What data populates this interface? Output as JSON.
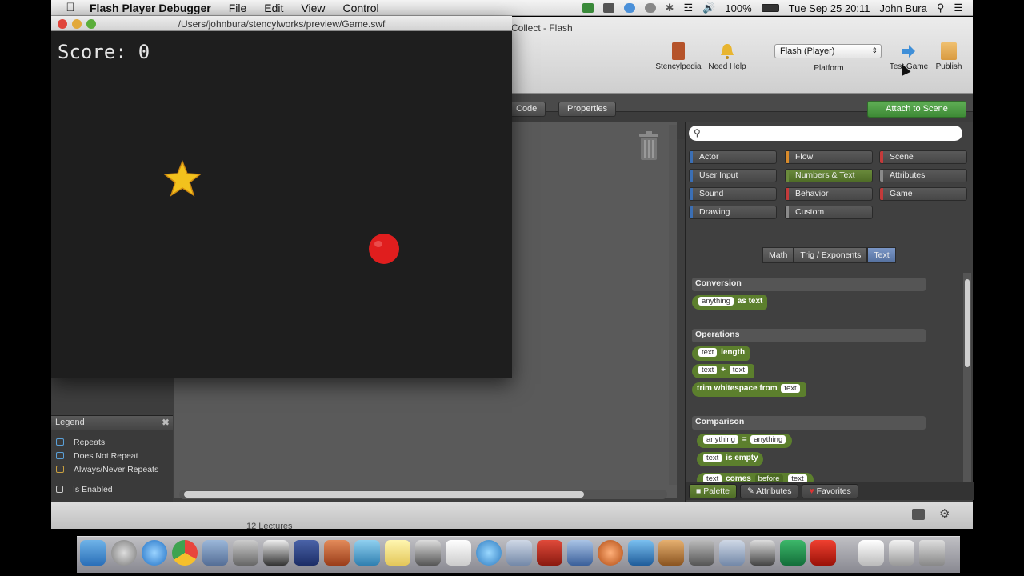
{
  "menubar": {
    "app_name": "Flash Player Debugger",
    "menus": [
      "File",
      "Edit",
      "View",
      "Control"
    ],
    "battery": "100%",
    "clock": "Tue Sep 25  20:11",
    "user": "John Bura"
  },
  "stencyl": {
    "title": "Collect - Flash",
    "toolbar": {
      "stencylpedia": "Stencylpedia",
      "need_help": "Need Help",
      "platform_value": "Flash (Player)",
      "platform_label": "Platform",
      "test_game": "Test Game",
      "publish": "Publish"
    },
    "tabs": {
      "code": "Code",
      "properties": "Properties",
      "attach": "Attach to Scene"
    },
    "legend": {
      "title": "Legend",
      "items": [
        "Repeats",
        "Does Not Repeat",
        "Always/Never Repeats",
        "Is Enabled"
      ]
    },
    "palette": {
      "categories": [
        {
          "label": "Actor",
          "color": "#3b6fb5"
        },
        {
          "label": "Flow",
          "color": "#d98b2b"
        },
        {
          "label": "Scene",
          "color": "#c43a3a"
        },
        {
          "label": "User Input",
          "color": "#3b6fb5"
        },
        {
          "label": "Numbers & Text",
          "color": "#6b8b3c"
        },
        {
          "label": "Attributes",
          "color": "#8a8a8a"
        },
        {
          "label": "Sound",
          "color": "#3b6fb5"
        },
        {
          "label": "Behavior",
          "color": "#c43a3a"
        },
        {
          "label": "Game",
          "color": "#c43a3a"
        },
        {
          "label": "Drawing",
          "color": "#3b6fb5"
        },
        {
          "label": "Custom",
          "color": "#8a8a8a"
        }
      ],
      "subtabs": [
        "Math",
        "Trig / Exponents",
        "Text"
      ],
      "sections": {
        "conversion": "Conversion",
        "operations": "Operations",
        "comparison": "Comparison"
      },
      "blocks": {
        "as_text": {
          "slot": "anything",
          "label": "as text"
        },
        "length": {
          "slot": "text",
          "label": "length"
        },
        "concat": {
          "a": "text",
          "op": "+",
          "b": "text"
        },
        "trim": {
          "label": "trim whitespace from",
          "slot": "text"
        },
        "equals": {
          "a": "anything",
          "op": "=",
          "b": "anything"
        },
        "is_empty": {
          "slot": "text",
          "label": "is empty"
        },
        "comes": {
          "a": "text",
          "label": "comes",
          "dropdown": "before",
          "b": "text"
        }
      },
      "bottom_tabs": [
        "Palette",
        "Attributes",
        "Favorites"
      ]
    },
    "status_text": "12 Lectures"
  },
  "flash": {
    "path": "/Users/johnbura/stencylworks/preview/Game.swf",
    "score_label": "Score:",
    "score_value": "0"
  }
}
